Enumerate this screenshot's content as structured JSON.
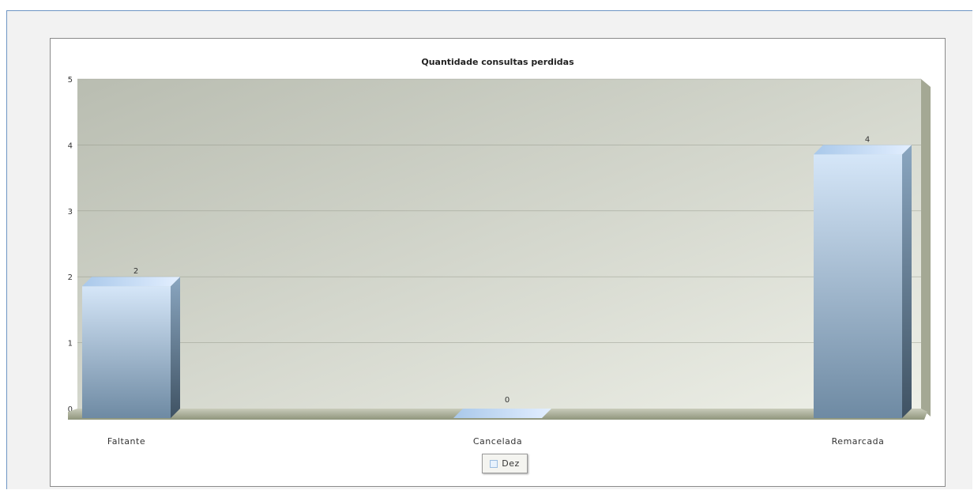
{
  "chart_data": {
    "type": "bar",
    "title": "Quantidade consultas perdidas",
    "categories": [
      "Faltante",
      "Cancelada",
      "Remarcada"
    ],
    "series": [
      {
        "name": "Dez",
        "values": [
          2,
          0,
          4
        ]
      }
    ],
    "ylim": [
      0,
      5
    ],
    "yticks": [
      0,
      1,
      2,
      3,
      4,
      5
    ],
    "grid": true,
    "legend_position": "bottom-center",
    "colors": {
      "bar_light": "#d5e6f8",
      "bar_dark": "#6e8aa3",
      "bar_side": "#4a6074",
      "plot_light": "#eef0e8",
      "plot_dark": "#b8bcb0",
      "floor": "#a9ae96"
    }
  },
  "legend": {
    "label": "Dez"
  }
}
